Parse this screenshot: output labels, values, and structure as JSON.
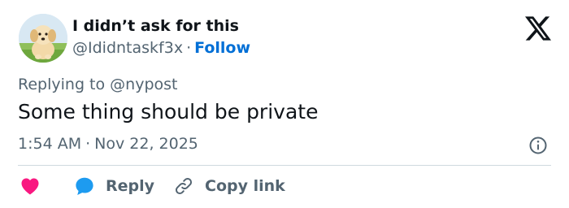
{
  "author": {
    "display_name": "I didn’t ask for this",
    "handle": "@Ididntaskf3x",
    "separator": "·",
    "follow_label": "Follow",
    "avatar_icon": "golden-retriever-puppy-avatar"
  },
  "tweet": {
    "replying_to": "Replying to @nypost",
    "text": "Some thing should be private",
    "time": "1:54 AM",
    "date_separator": "·",
    "date": "Nov 22, 2025"
  },
  "actions": {
    "reply_label": "Reply",
    "copy_link_label": "Copy link"
  },
  "icons": {
    "platform_logo": "x-logo-icon",
    "info": "info-icon",
    "like": "heart-icon",
    "reply": "speech-bubble-icon",
    "copy": "link-icon"
  },
  "colors": {
    "text_primary": "#0f1419",
    "text_secondary": "#536471",
    "link_blue": "#006fd6",
    "like_pink": "#f91880",
    "reply_blue": "#1d9bf0",
    "divider": "#cfd9de"
  }
}
